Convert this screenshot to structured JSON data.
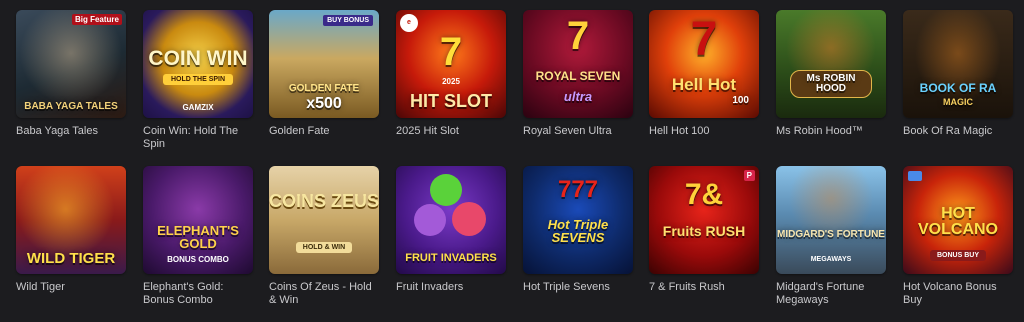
{
  "games_row1": [
    {
      "title": "Baba Yaga Tales",
      "art_top": "",
      "art_main": "BABA YAGA TALES",
      "art_sub": "",
      "badge": "Big Feature"
    },
    {
      "title": "Coin Win: Hold The Spin",
      "art_top": "",
      "art_main": "COIN WIN",
      "art_sub": "HOLD THE SPIN",
      "badge": "GAMZIX"
    },
    {
      "title": "Golden Fate",
      "art_top": "BUY BONUS",
      "art_main": "GOLDEN FATE",
      "art_sub": "x500",
      "badge": ""
    },
    {
      "title": "2025 Hit Slot",
      "art_top": "2025",
      "art_main": "HIT SLOT",
      "art_sub": "7",
      "badge": ""
    },
    {
      "title": "Royal Seven Ultra",
      "art_top": "7",
      "art_main": "ROYAL SEVEN",
      "art_sub": "ultra",
      "badge": ""
    },
    {
      "title": "Hell Hot 100",
      "art_top": "7",
      "art_main": "Hell Hot",
      "art_sub": "100",
      "badge": ""
    },
    {
      "title": "Ms Robin Hood™",
      "art_top": "",
      "art_main": "Ms ROBIN HOOD",
      "art_sub": "",
      "badge": ""
    },
    {
      "title": "Book Of Ra Magic",
      "art_top": "",
      "art_main": "BOOK OF RA",
      "art_sub": "MAGIC",
      "badge": ""
    }
  ],
  "games_row2": [
    {
      "title": "Wild Tiger",
      "art_top": "",
      "art_main": "WILD TIGER",
      "art_sub": "",
      "badge": ""
    },
    {
      "title": "Elephant's Gold: Bonus Combo",
      "art_top": "",
      "art_main": "ELEPHANT'S GOLD",
      "art_sub": "BONUS COMBO",
      "badge": ""
    },
    {
      "title": "Coins Of Zeus - Hold & Win",
      "art_top": "",
      "art_main": "COINS ZEUS",
      "art_sub": "HOLD & WIN",
      "badge": ""
    },
    {
      "title": "Fruit Invaders",
      "art_top": "",
      "art_main": "FRUIT INVADERS",
      "art_sub": "",
      "badge": ""
    },
    {
      "title": "Hot Triple Sevens",
      "art_top": "777",
      "art_main": "Hot Triple SEVENS",
      "art_sub": "",
      "badge": ""
    },
    {
      "title": "7 & Fruits Rush",
      "art_top": "7&",
      "art_main": "Fruits RUSH",
      "art_sub": "",
      "badge": "P"
    },
    {
      "title": "Midgard's Fortune Megaways",
      "art_top": "",
      "art_main": "MIDGARD'S FORTUNE",
      "art_sub": "MEGAWAYS",
      "badge": ""
    },
    {
      "title": "Hot Volcano Bonus Buy",
      "art_top": "",
      "art_main": "HOT VOLCANO",
      "art_sub": "BONUS BUY",
      "badge": ""
    }
  ],
  "colors": {
    "background": "#1c1c1f",
    "title_text": "#c9c9cc"
  }
}
